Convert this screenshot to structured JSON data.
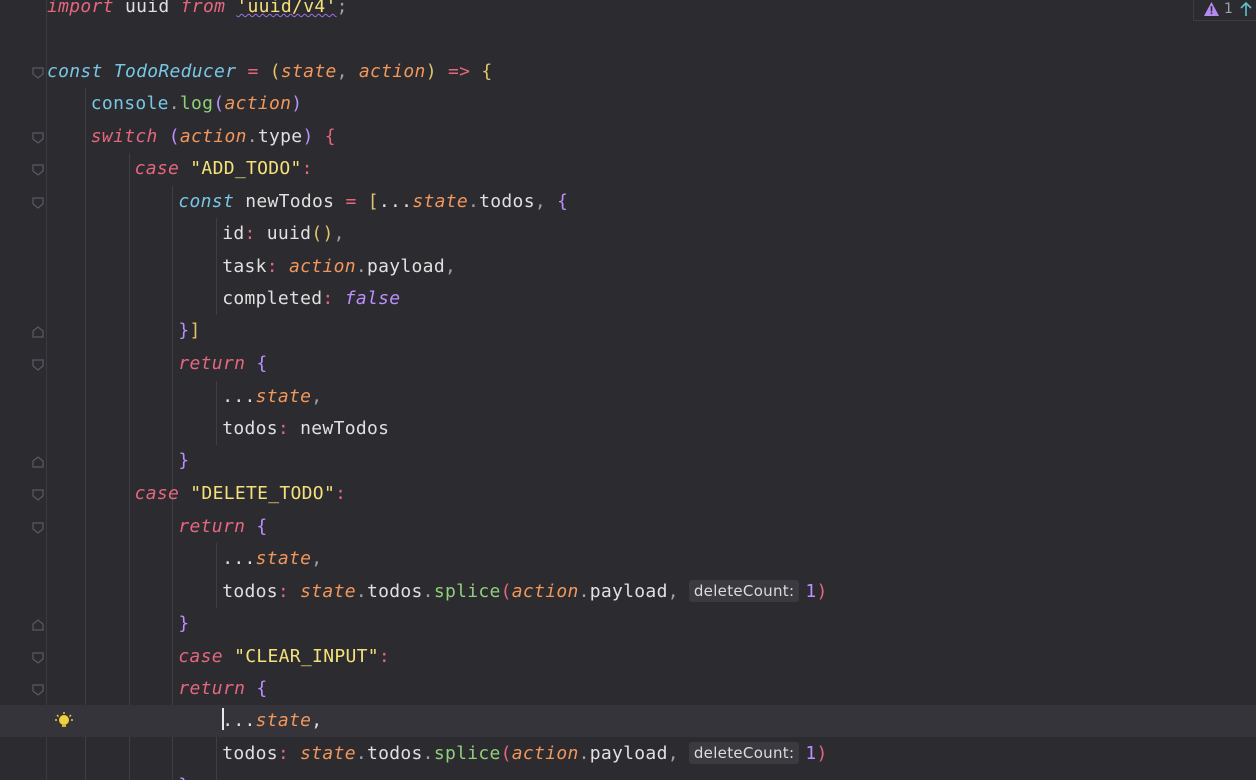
{
  "inspection": {
    "warning_count": "1"
  },
  "hints": {
    "param_name": "deleteCount:"
  },
  "tokens": {
    "import": "import",
    "uuid": "uuid",
    "from": "from",
    "uuid_path": "'uuid/v4'",
    "semicolon": ";",
    "const": "const",
    "todo_reducer": "TodoReducer",
    "eq": "=",
    "state": "state",
    "action": "action",
    "arrow": "=>",
    "console": "console",
    "log": "log",
    "switch": "switch",
    "type": "type",
    "case": "case",
    "add_todo": "\"ADD_TODO\"",
    "delete_todo": "\"DELETE_TODO\"",
    "clear_input": "\"CLEAR_INPUT\"",
    "new_todos": "newTodos",
    "spread": "...",
    "todos": "todos",
    "id": "id",
    "task": "task",
    "payload": "payload",
    "completed": "completed",
    "false": "false",
    "return": "return",
    "splice": "splice",
    "one": "1"
  }
}
